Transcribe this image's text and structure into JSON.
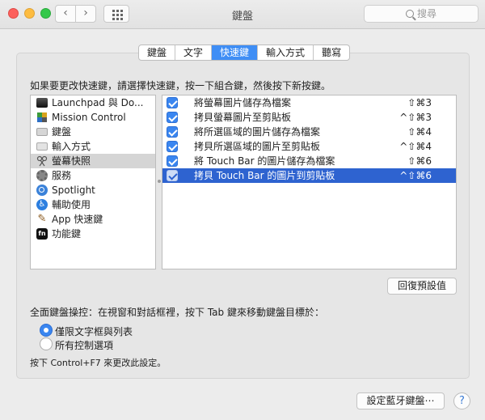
{
  "window": {
    "title": "鍵盤"
  },
  "toolbar": {
    "back_glyph": "‹",
    "forward_glyph": "›",
    "search_placeholder": "搜尋"
  },
  "tabs": [
    {
      "label": "鍵盤",
      "active": false
    },
    {
      "label": "文字",
      "active": false
    },
    {
      "label": "快速鍵",
      "active": true
    },
    {
      "label": "輸入方式",
      "active": false
    },
    {
      "label": "聽寫",
      "active": false
    }
  ],
  "instruction": "如果要更改快速鍵，請選擇快速鍵，按一下組合鍵，然後按下新按鍵。",
  "categories": [
    {
      "label": "Launchpad 與 Do...",
      "icon": "launchpad-icon"
    },
    {
      "label": "Mission Control",
      "icon": "mission-control-icon"
    },
    {
      "label": "鍵盤",
      "icon": "keyboard-icon"
    },
    {
      "label": "輸入方式",
      "icon": "input-source-icon"
    },
    {
      "label": "螢幕快照",
      "icon": "screenshot-icon",
      "selected": true
    },
    {
      "label": "服務",
      "icon": "services-gear-icon"
    },
    {
      "label": "Spotlight",
      "icon": "spotlight-icon"
    },
    {
      "label": "輔助使用",
      "icon": "accessibility-icon"
    },
    {
      "label": "App 快速鍵",
      "icon": "app-shortcuts-icon"
    },
    {
      "label": "功能鍵",
      "icon": "fn-key-icon"
    }
  ],
  "shortcuts": [
    {
      "name": "將螢幕圖片儲存為檔案",
      "keys": "⇧⌘3",
      "checked": true
    },
    {
      "name": "拷貝螢幕圖片至剪貼板",
      "keys": "^⇧⌘3",
      "checked": true
    },
    {
      "name": "將所選區域的圖片儲存為檔案",
      "keys": "⇧⌘4",
      "checked": true
    },
    {
      "name": "拷貝所選區域的圖片至剪貼板",
      "keys": "^⇧⌘4",
      "checked": true
    },
    {
      "name": "將 Touch Bar 的圖片儲存為檔案",
      "keys": "⇧⌘6",
      "checked": true
    },
    {
      "name": "拷貝 Touch Bar 的圖片到剪貼板",
      "keys": "^⇧⌘6",
      "checked": true,
      "selected": true
    }
  ],
  "restore_defaults": "回復預設值",
  "full_keyboard": {
    "label": "全面鍵盤操控：在視窗和對話框裡，按下 Tab 鍵來移動鍵盤目標於：",
    "options": [
      {
        "label": "僅限文字框與列表",
        "selected": true
      },
      {
        "label": "所有控制選項",
        "selected": false
      }
    ],
    "hint": "按下 Control+F7 來更改此設定。"
  },
  "bluetooth_button": "設定藍牙鍵盤⋯",
  "help_glyph": "?",
  "colors": {
    "accent": "#3f8ef5",
    "selection": "#2e63d0"
  }
}
